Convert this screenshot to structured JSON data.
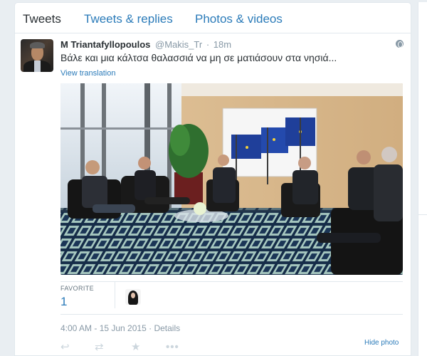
{
  "tabs": [
    {
      "label": "Tweets",
      "active": true
    },
    {
      "label": "Tweets & replies",
      "active": false
    },
    {
      "label": "Photos & videos",
      "active": false
    }
  ],
  "tweet": {
    "author_name": "M Triantafyllopoulos",
    "handle": "@Makis_Tr",
    "separator": "·",
    "time_ago": "18m",
    "text": "Βάλε και μια κάλτσα θαλασσιά να μη σε ματιάσουν στα νησιά...",
    "translate_link": "View translation",
    "photo_icon": "eu-meeting-photo",
    "favorite_label": "FAVORITE",
    "favorite_count": "1",
    "timestamp": "4:00 AM - 15 Jun 2015",
    "timestamp_sep": "·",
    "details_link": "Details",
    "hide_photo_link": "Hide photo",
    "actions": {
      "reply_icon": "↩",
      "retweet_icon": "⇄",
      "favorite_icon": "★",
      "more_icon": "•••"
    }
  },
  "colors": {
    "link": "#2b7bb9",
    "text": "#292f33",
    "muted": "#8899a6",
    "border": "#e1e8ed",
    "eu_blue": "#1f3f9a",
    "eu_star": "#f2d13a"
  }
}
